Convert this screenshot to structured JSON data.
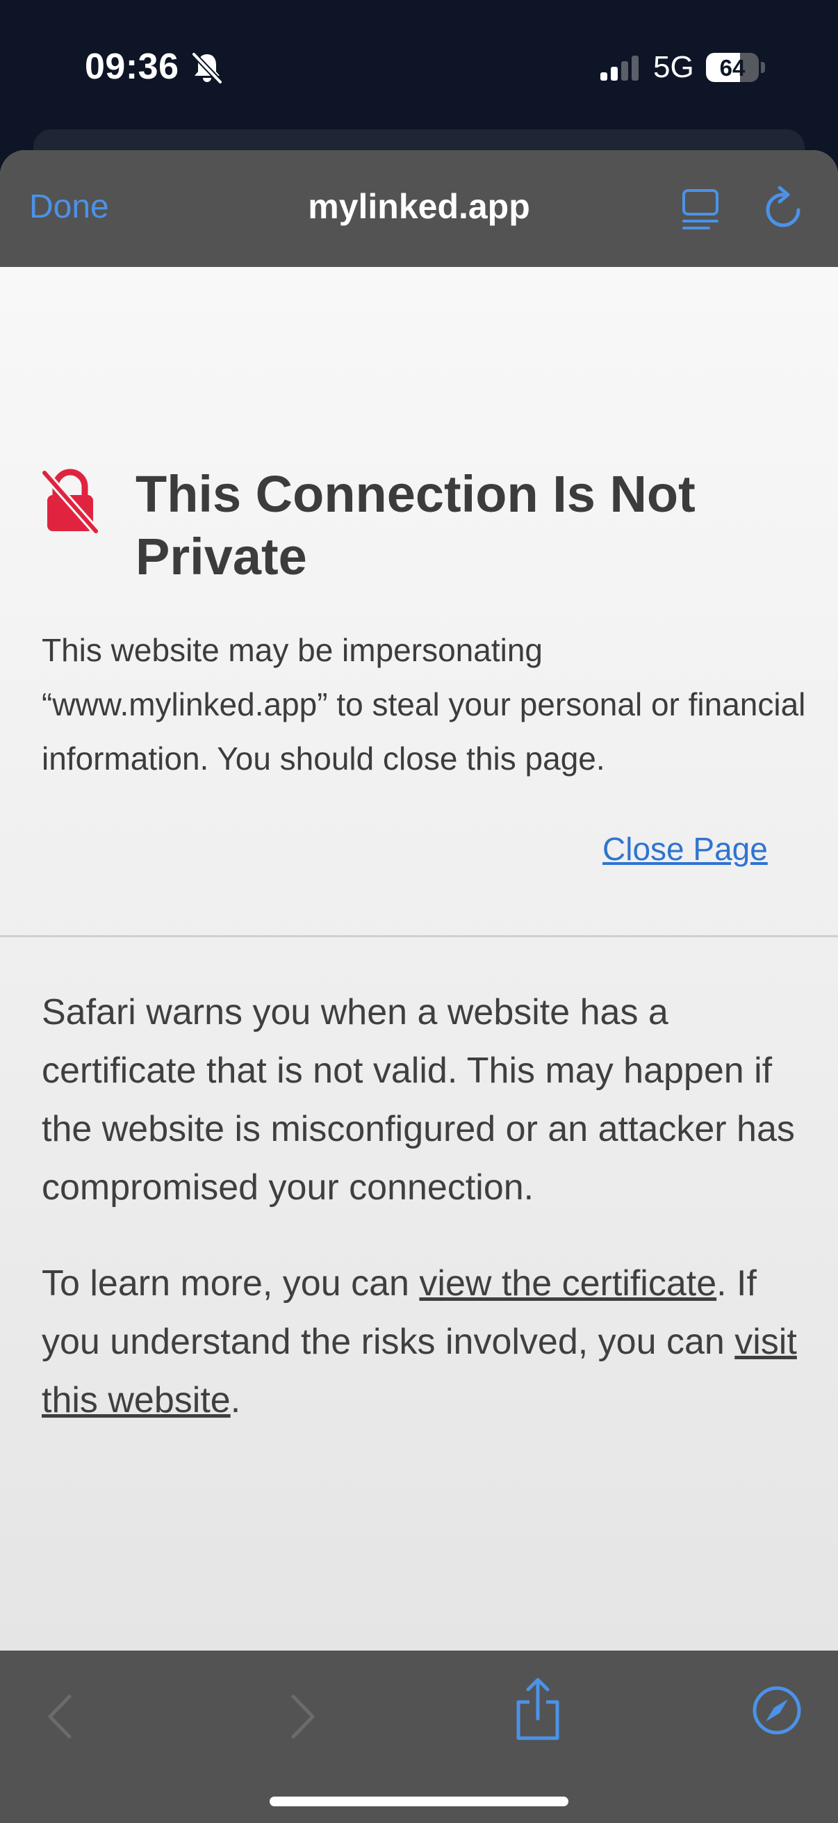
{
  "status_bar": {
    "time": "09:36",
    "network": "5G",
    "battery_percent": "64",
    "battery_level": 0.64,
    "signal_bars_active": 2,
    "signal_bars_total": 4,
    "icons": [
      "bell-off-icon",
      "signal-icon",
      "battery-icon"
    ]
  },
  "nav": {
    "done_label": "Done",
    "title": "mylinked.app",
    "icons": [
      "reader-icon",
      "reload-icon"
    ]
  },
  "warning": {
    "title": "This Connection Is Not Private",
    "text": "This website may be impersonating “www.mylinked.app” to steal your personal or financial information. You should close this page.",
    "close_link": "Close Page",
    "explain": "Safari warns you when a website has a certificate that is not valid. This may happen if the website is misconfigured or an attacker has compromised your connection.",
    "learn_prefix": "To learn more, you can ",
    "view_cert_link": "view the certificate",
    "learn_middle": ". If you understand the risks involved, you can ",
    "visit_link": "visit this website",
    "learn_suffix": "."
  },
  "toolbar": {
    "icons": [
      "back-icon",
      "forward-icon",
      "share-icon",
      "compass-icon"
    ]
  },
  "colors": {
    "accent": "#4b92e8",
    "warning_red": "#e0243f",
    "bar_gray": "#535353",
    "status_bg": "#0d1526"
  }
}
